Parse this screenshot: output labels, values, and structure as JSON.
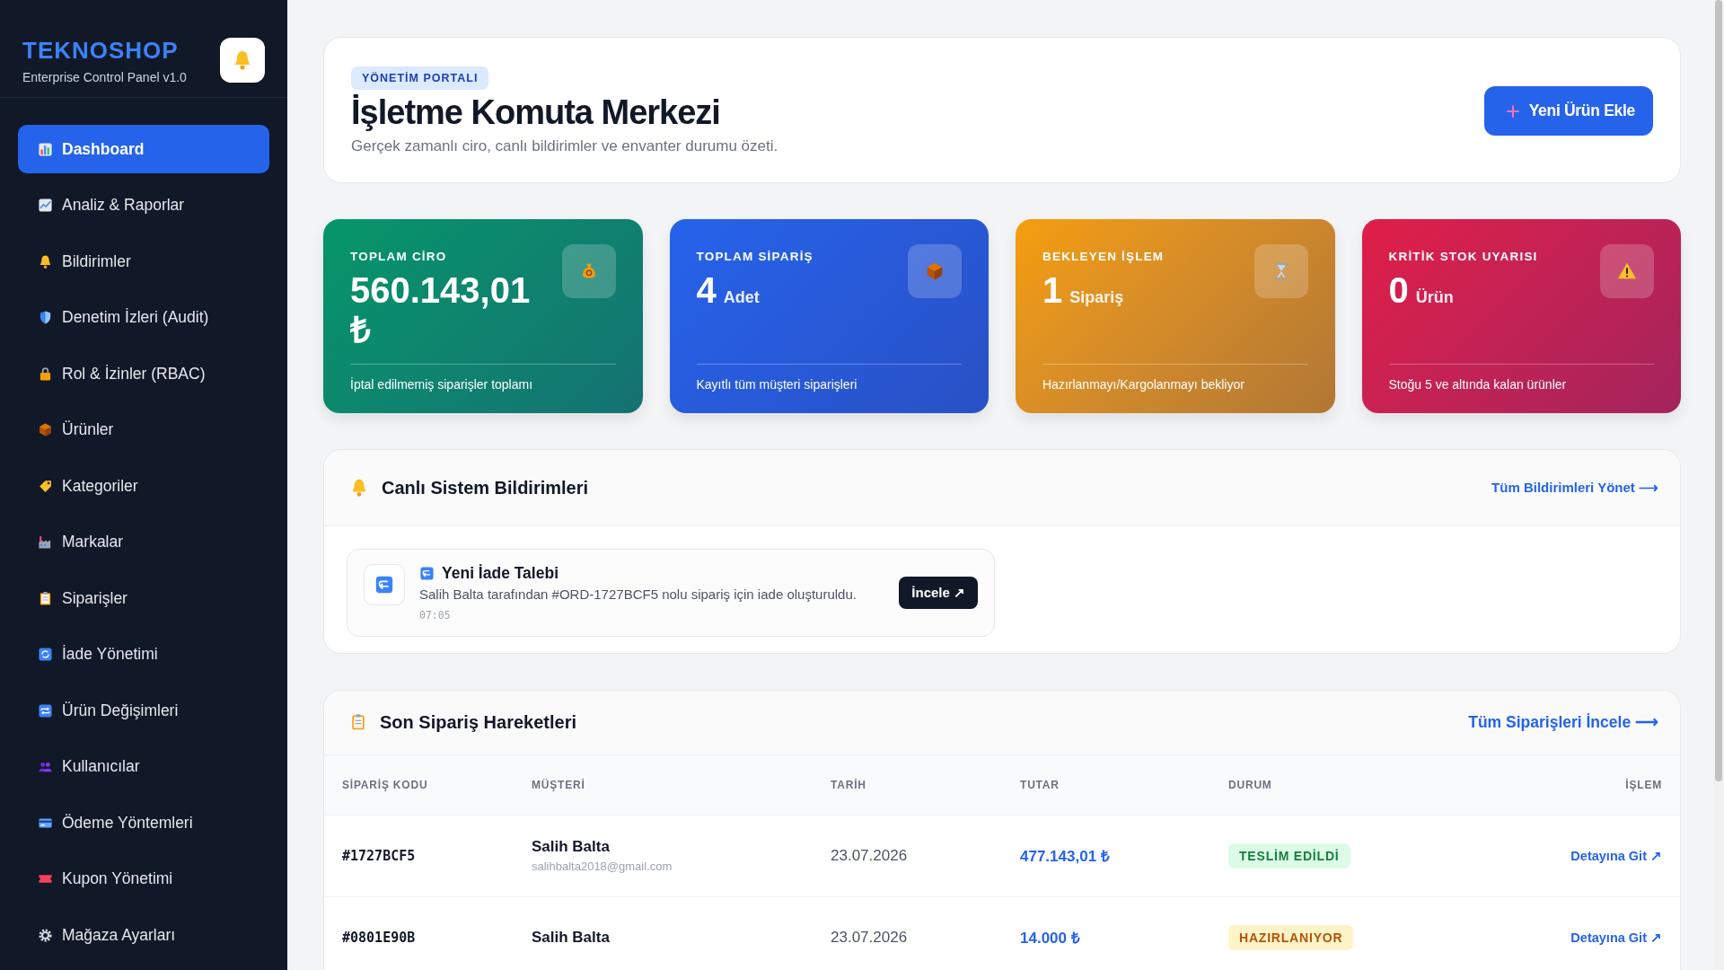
{
  "sidebar": {
    "brand": "TEKNOSHOP",
    "subtitle": "Enterprise Control Panel v1.0",
    "items": [
      {
        "label": "Dashboard",
        "selected": true
      },
      {
        "label": "Analiz & Raporlar",
        "selected": false
      },
      {
        "label": "Bildirimler",
        "selected": false
      },
      {
        "label": "Denetim İzleri (Audit)",
        "selected": false
      },
      {
        "label": "Rol & İzinler (RBAC)",
        "selected": false
      },
      {
        "label": "Ürünler",
        "selected": false
      },
      {
        "label": "Kategoriler",
        "selected": false
      },
      {
        "label": "Markalar",
        "selected": false
      },
      {
        "label": "Siparişler",
        "selected": false
      },
      {
        "label": "İade Yönetimi",
        "selected": false
      },
      {
        "label": "Ürün Değişimleri",
        "selected": false
      },
      {
        "label": "Kullanıcılar",
        "selected": false
      },
      {
        "label": "Ödeme Yöntemleri",
        "selected": false
      },
      {
        "label": "Kupon Yönetimi",
        "selected": false
      },
      {
        "label": "Mağaza Ayarları",
        "selected": false
      }
    ]
  },
  "header": {
    "badge": "YÖNETİM PORTALI",
    "title": "İşletme Komuta Merkezi",
    "subtitle": "Gerçek zamanlı ciro, canlı bildirimler ve envanter durumu özeti.",
    "button": "Yeni Ürün Ekle"
  },
  "stats": [
    {
      "label": "TOPLAM CİRO",
      "value": "560.143,01 ₺",
      "note": "İptal edilmemiş siparişler toplamı",
      "color": "#059669"
    },
    {
      "label": "TOPLAM SİPARİŞ",
      "value": "4",
      "unit": "Adet",
      "note": "Kayıtlı tüm müşteri siparişleri",
      "color": "#2563eb"
    },
    {
      "label": "BEKLEYEN İŞLEM",
      "value": "1",
      "unit": "Sipariş",
      "note": "Hazırlanmayı/Kargolanmayı bekliyor",
      "color": "#f59e0b"
    },
    {
      "label": "KRİTİK STOK UYARISI",
      "value": "0",
      "unit": "Ürün",
      "note": "Stoğu 5 ve altında kalan ürünler",
      "color": "#e11d48"
    }
  ],
  "notifications": {
    "title": "Canlı Sistem Bildirimleri",
    "link": "Tüm Bildirimleri Yönet ⟶",
    "items": [
      {
        "title": "Yeni İade Talebi",
        "message": "Salih Balta tarafından #ORD-1727BCF5 nolu sipariş için iade oluşturuldu.",
        "time": "07:05",
        "button": "İncele ↗"
      }
    ]
  },
  "orders": {
    "title": "Son Sipariş Hareketleri",
    "link": "Tüm Siparişleri İncele ⟶",
    "columns": [
      "SİPARİŞ KODU",
      "MÜŞTERİ",
      "TARİH",
      "TUTAR",
      "DURUM",
      "İŞLEM"
    ],
    "rows": [
      {
        "code": "#1727BCF5",
        "customer": "Salih Balta",
        "email": "salihbalta2018@gmail.com",
        "date": "23.07.2026",
        "amount": "477.143,01 ₺",
        "status": "TESLİM EDİLDİ",
        "kind": "delivered",
        "action": "Detayına Git ↗"
      },
      {
        "code": "#0801E90B",
        "customer": "Salih Balta",
        "date": "23.07.2026",
        "amount": "14.000 ₺",
        "status": "HAZIRLANIYOR",
        "kind": "preparing",
        "action": "Detayına Git ↗"
      }
    ]
  }
}
